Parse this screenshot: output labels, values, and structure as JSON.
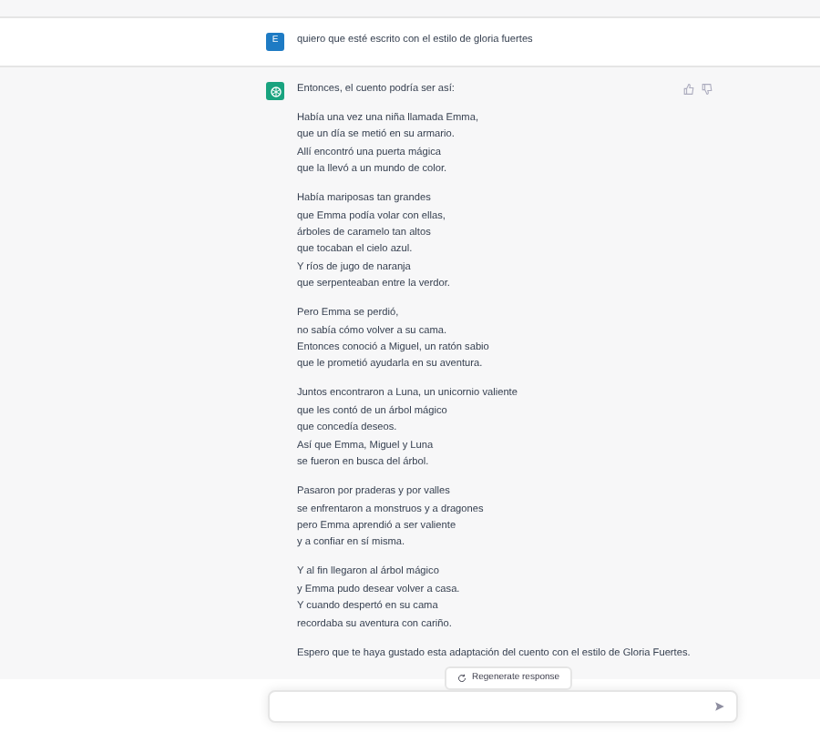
{
  "messages": [
    {
      "kind": "user",
      "avatar": "E",
      "text": "quiero que esté escrito con el estilo de gloria fuertes"
    },
    {
      "kind": "assistant",
      "intro": "Entonces, el cuento podría ser así:",
      "stanzas": [
        [
          "Había una vez una niña llamada Emma,",
          "que un día se metió en su armario.",
          "Allí encontró una puerta mágica",
          "que la llevó a un mundo de color."
        ],
        [
          "Había mariposas tan grandes",
          "que Emma podía volar con ellas,",
          "árboles de caramelo tan altos",
          "que tocaban el cielo azul.",
          "Y ríos de jugo de naranja",
          "que serpenteaban entre la verdor."
        ],
        [
          "Pero Emma se perdió,",
          "no sabía cómo volver a su cama.",
          "Entonces conoció a Miguel, un ratón sabio",
          "que le prometió ayudarla en su aventura."
        ],
        [
          "Juntos encontraron a Luna, un unicornio valiente",
          "que les contó de un árbol mágico",
          "que concedía deseos.",
          "Así que Emma, Miguel y Luna",
          "se fueron en busca del árbol."
        ],
        [
          "Pasaron por praderas y por valles",
          "se enfrentaron a monstruos y a dragones",
          "pero Emma aprendió a ser valiente",
          "y a confiar en sí misma."
        ],
        [
          "Y al fin llegaron al árbol mágico",
          "y Emma pudo desear volver a casa.",
          "Y cuando despertó en su cama",
          "recordaba su aventura con cariño."
        ]
      ],
      "closing": "Espero que te haya gustado esta adaptación del cuento con el estilo de Gloria Fuertes."
    }
  ],
  "regenerate_button": "Regenerate response"
}
